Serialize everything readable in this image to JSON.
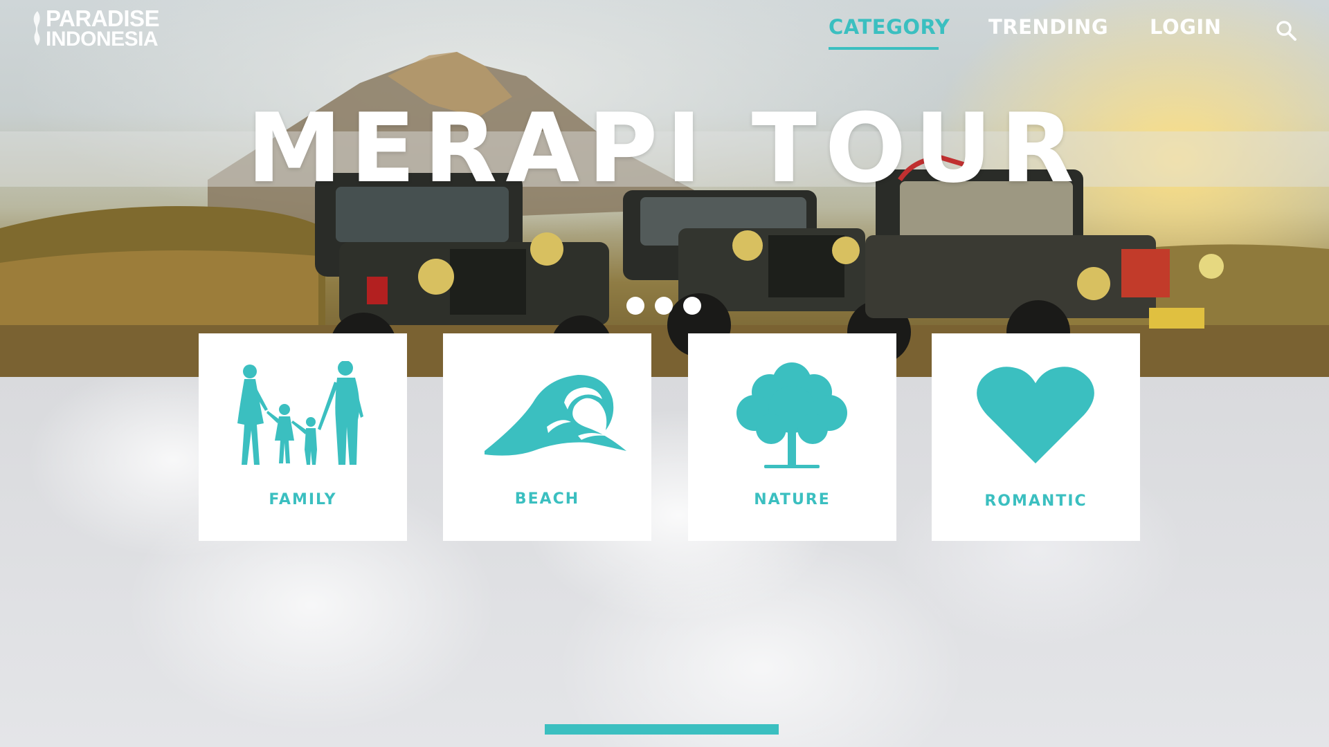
{
  "brand": {
    "line1": "PARADISE",
    "line2": "INDONESIA"
  },
  "nav": {
    "items": [
      {
        "label": "CATEGORY",
        "active": true
      },
      {
        "label": "TRENDING",
        "active": false
      },
      {
        "label": "LOGIN",
        "active": false
      }
    ],
    "search_icon": "search-icon"
  },
  "hero": {
    "title": "MERAPI TOUR",
    "carousel_dots": 3
  },
  "categories": [
    {
      "label": "FAMILY",
      "icon": "family-icon"
    },
    {
      "label": "BEACH",
      "icon": "wave-icon"
    },
    {
      "label": "NATURE",
      "icon": "tree-icon"
    },
    {
      "label": "ROMANTIC",
      "icon": "heart-icon"
    }
  ],
  "colors": {
    "accent": "#3bbfc0",
    "card_bg": "#ffffff"
  }
}
